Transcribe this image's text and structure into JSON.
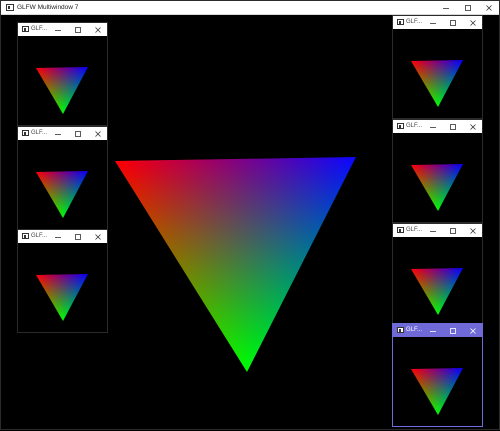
{
  "main_window": {
    "title": "GLFW Multiwindow 7",
    "controls": [
      "minimize",
      "maximize",
      "close"
    ]
  },
  "child_windows": [
    {
      "title": "GLF...",
      "active": false
    },
    {
      "title": "GLF...",
      "active": false
    },
    {
      "title": "GLF...",
      "active": false
    },
    {
      "title": "GLF...",
      "active": false
    },
    {
      "title": "GLF...",
      "active": false
    },
    {
      "title": "GLF...",
      "active": false
    },
    {
      "title": "GLF...",
      "active": true
    }
  ],
  "icons": {
    "app": "window-app-icon",
    "minimize": "minimize-icon",
    "maximize": "maximize-icon",
    "close": "close-icon"
  },
  "colors": {
    "vertex_left": "#ff0000",
    "vertex_right": "#0000ff",
    "vertex_bottom": "#00ff00",
    "active_titlebar": "#6f6ad8",
    "background": "#000000"
  }
}
